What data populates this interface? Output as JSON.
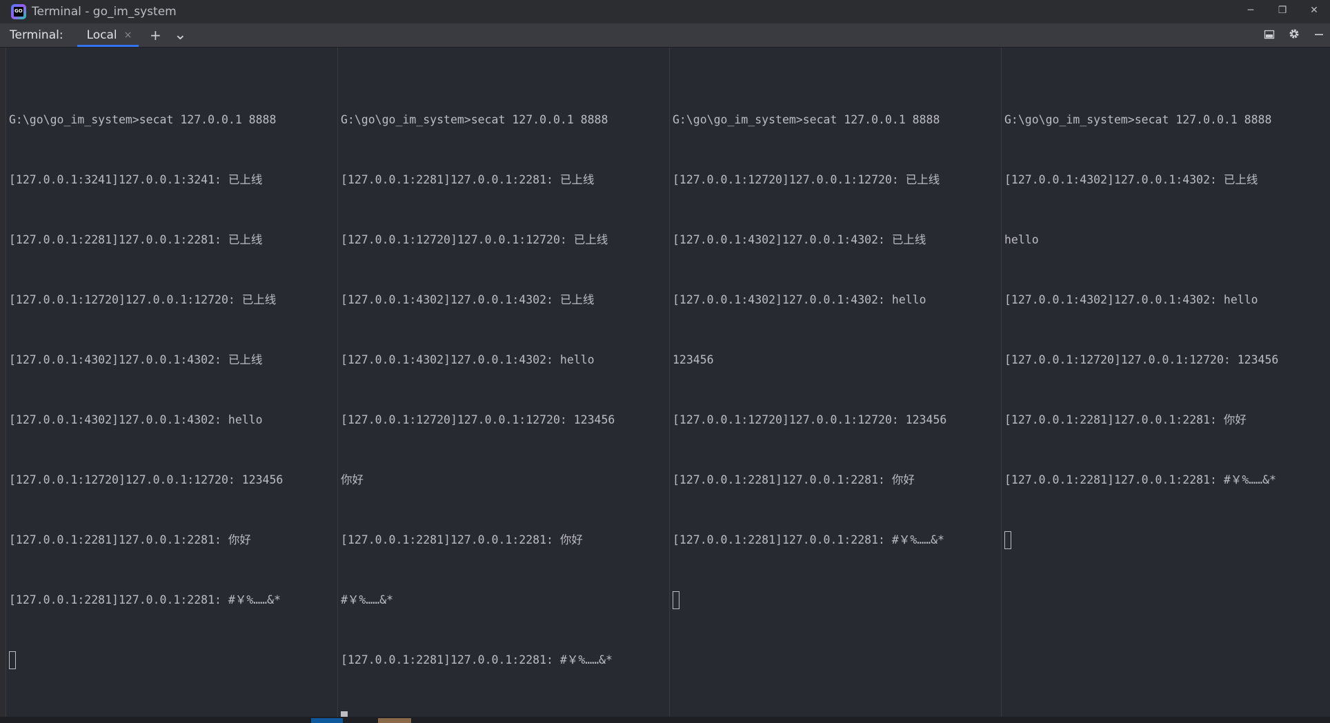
{
  "window": {
    "title": "Terminal - go_im_system",
    "app_icon_text": "GO",
    "controls": {
      "minimize": "─",
      "restore": "❐",
      "close": "✕"
    }
  },
  "toolbar": {
    "label": "Terminal:",
    "tab_label": "Local",
    "tab_close": "×",
    "add_icon": "+",
    "dropdown_icon": "⌄",
    "right_icons": [
      "layout-icon",
      "gear-icon",
      "minimize-icon"
    ]
  },
  "panes": [
    {
      "lines": [
        "G:\\go\\go_im_system>secat 127.0.0.1 8888",
        "[127.0.0.1:3241]127.0.0.1:3241: 已上线",
        "[127.0.0.1:2281]127.0.0.1:2281: 已上线",
        "[127.0.0.1:12720]127.0.0.1:12720: 已上线",
        "[127.0.0.1:4302]127.0.0.1:4302: 已上线",
        "[127.0.0.1:4302]127.0.0.1:4302: hello",
        "[127.0.0.1:12720]127.0.0.1:12720: 123456",
        "[127.0.0.1:2281]127.0.0.1:2281: 你好",
        "[127.0.0.1:2281]127.0.0.1:2281: #￥%……&*"
      ],
      "cursor": "outline"
    },
    {
      "lines": [
        "G:\\go\\go_im_system>secat 127.0.0.1 8888",
        "[127.0.0.1:2281]127.0.0.1:2281: 已上线",
        "[127.0.0.1:12720]127.0.0.1:12720: 已上线",
        "[127.0.0.1:4302]127.0.0.1:4302: 已上线",
        "[127.0.0.1:4302]127.0.0.1:4302: hello",
        "[127.0.0.1:12720]127.0.0.1:12720: 123456",
        "你好",
        "[127.0.0.1:2281]127.0.0.1:2281: 你好",
        "#￥%……&*",
        "[127.0.0.1:2281]127.0.0.1:2281: #￥%……&*"
      ],
      "cursor": "solid"
    },
    {
      "lines": [
        "G:\\go\\go_im_system>secat 127.0.0.1 8888",
        "[127.0.0.1:12720]127.0.0.1:12720: 已上线",
        "[127.0.0.1:4302]127.0.0.1:4302: 已上线",
        "[127.0.0.1:4302]127.0.0.1:4302: hello",
        "123456",
        "[127.0.0.1:12720]127.0.0.1:12720: 123456",
        "[127.0.0.1:2281]127.0.0.1:2281: 你好",
        "[127.0.0.1:2281]127.0.0.1:2281: #￥%……&*"
      ],
      "cursor": "outline"
    },
    {
      "lines": [
        "G:\\go\\go_im_system>secat 127.0.0.1 8888",
        "[127.0.0.1:4302]127.0.0.1:4302: 已上线",
        "hello",
        "[127.0.0.1:4302]127.0.0.1:4302: hello",
        "[127.0.0.1:12720]127.0.0.1:12720: 123456",
        "[127.0.0.1:2281]127.0.0.1:2281: 你好",
        "[127.0.0.1:2281]127.0.0.1:2281: #￥%……&*"
      ],
      "cursor": "outline"
    }
  ],
  "colors": {
    "background": "#282a31",
    "text": "#bcbec4",
    "tab_accent": "#3574f0"
  }
}
